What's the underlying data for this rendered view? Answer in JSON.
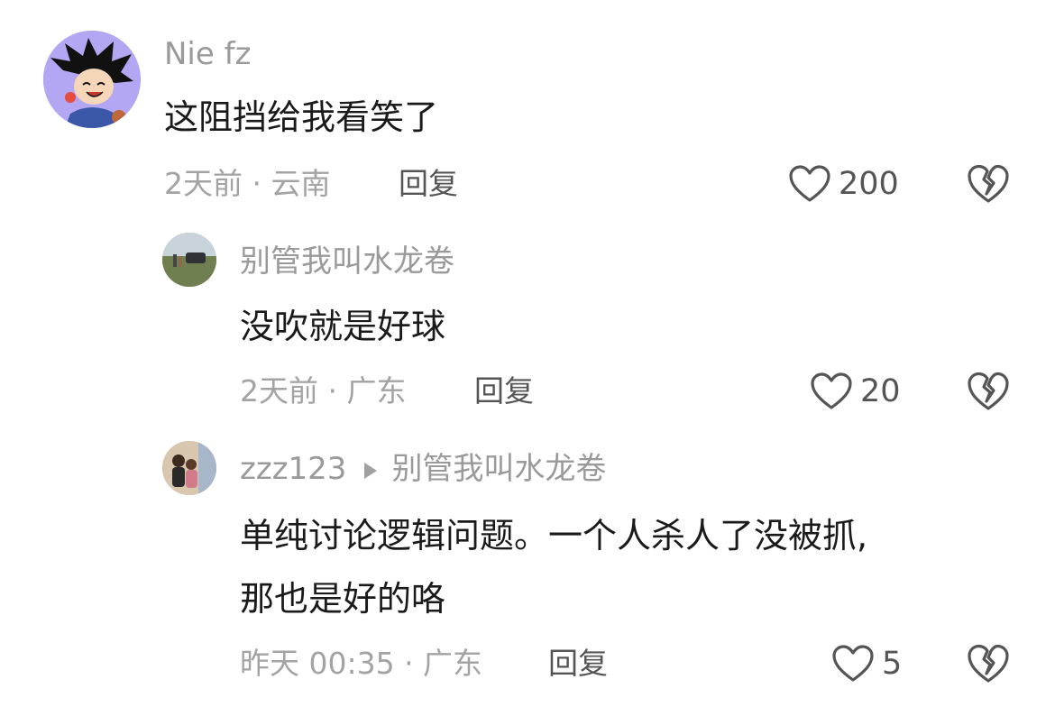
{
  "comments": [
    {
      "username": "Nie fz",
      "text": "这阻挡给我看笑了",
      "meta": "2天前 · 云南",
      "reply_label": "回复",
      "likes": "200",
      "avatar_icon": "cartoon-boy-avatar"
    },
    {
      "username": "别管我叫水龙卷",
      "text": "没吹就是好球",
      "meta": "2天前 · 广东",
      "reply_label": "回复",
      "likes": "20",
      "avatar_icon": "car-photo-avatar"
    },
    {
      "username": "zzz123",
      "reply_to": "别管我叫水龙卷",
      "text_line1": "单纯讨论逻辑问题。一个人杀人了没被抓,",
      "text_line2": "那也是好的咯",
      "meta": "昨天 00:35 · 广东",
      "reply_label": "回复",
      "likes": "5",
      "avatar_icon": "people-photo-avatar"
    }
  ],
  "icons": {
    "like": "heart-outline-icon",
    "dislike": "broken-heart-icon",
    "reply_to": "triangle-right-icon"
  },
  "colors": {
    "username": "#9a9a9a",
    "text": "#1a1a1a",
    "meta": "#a3a3a3",
    "action": "#555555",
    "avatar_bg_1": "#b3a6f2"
  }
}
